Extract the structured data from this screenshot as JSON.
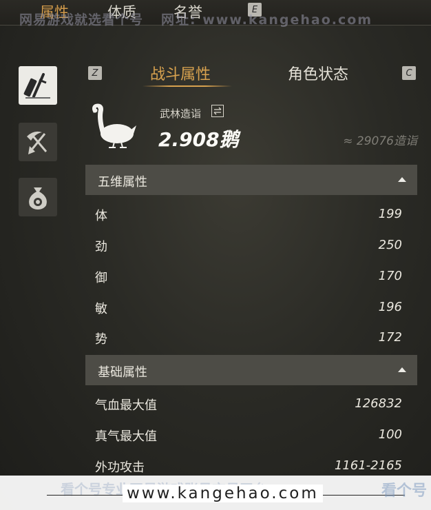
{
  "top_tabs": [
    {
      "label": "属性"
    },
    {
      "label": "体质"
    },
    {
      "label": "名誉"
    }
  ],
  "top_key": "E",
  "watermark": {
    "top_text": "网易游戏就选看个号",
    "top_url": "网址: www.kangehao.com",
    "bottom_url": "www.kangehao.com",
    "bottom_faint": "看个号专业网易游戏账号交易平台",
    "bottom_logo": "看个号"
  },
  "sidebar": [
    {
      "icon": "sword-scroll-icon",
      "active": true
    },
    {
      "icon": "shovel-pickaxe-icon",
      "active": false
    },
    {
      "icon": "money-bag-icon",
      "active": false
    }
  ],
  "panel": {
    "key_left": "Z",
    "key_right": "C",
    "tabs": [
      {
        "label": "战斗属性"
      },
      {
        "label": "角色状态"
      }
    ],
    "rank_label": "武林造诣",
    "rank_value": "2.908鹅",
    "approx_value": "≈ 29076造诣"
  },
  "sections": [
    {
      "title": "五维属性",
      "rows": [
        {
          "label": "体",
          "value": "199"
        },
        {
          "label": "劲",
          "value": "250"
        },
        {
          "label": "御",
          "value": "170"
        },
        {
          "label": "敏",
          "value": "196"
        },
        {
          "label": "势",
          "value": "172"
        }
      ]
    },
    {
      "title": "基础属性",
      "rows": [
        {
          "label": "气血最大值",
          "value": "126832"
        },
        {
          "label": "真气最大值",
          "value": "100"
        },
        {
          "label": "外功攻击",
          "value": "1161-2165"
        }
      ]
    }
  ],
  "colors": {
    "accent": "#d8a24f",
    "header_bg": "#4d4c46"
  }
}
